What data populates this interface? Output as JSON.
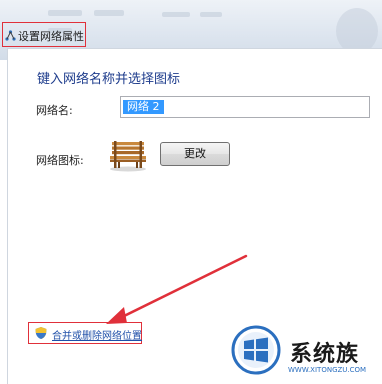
{
  "window": {
    "title": "设置网络属性",
    "title_icon": "network-icon"
  },
  "dialog": {
    "heading": "键入网络名称并选择图标",
    "network_name_label": "网络名:",
    "network_name_value": "网络 2",
    "network_icon_label": "网络图标:",
    "network_icon": "bench-icon",
    "change_button_label": "更改",
    "merge_link_label": "合并或删除网络位置",
    "merge_link_icon": "shield-icon"
  },
  "watermark": {
    "brand": "系统族",
    "url": "WWW.XITONGZU.COM"
  },
  "colors": {
    "annotation_red": "#e0303a",
    "heading_blue": "#1e3c8c",
    "link_blue": "#1f4fa8",
    "selection_blue": "#3399ff"
  }
}
